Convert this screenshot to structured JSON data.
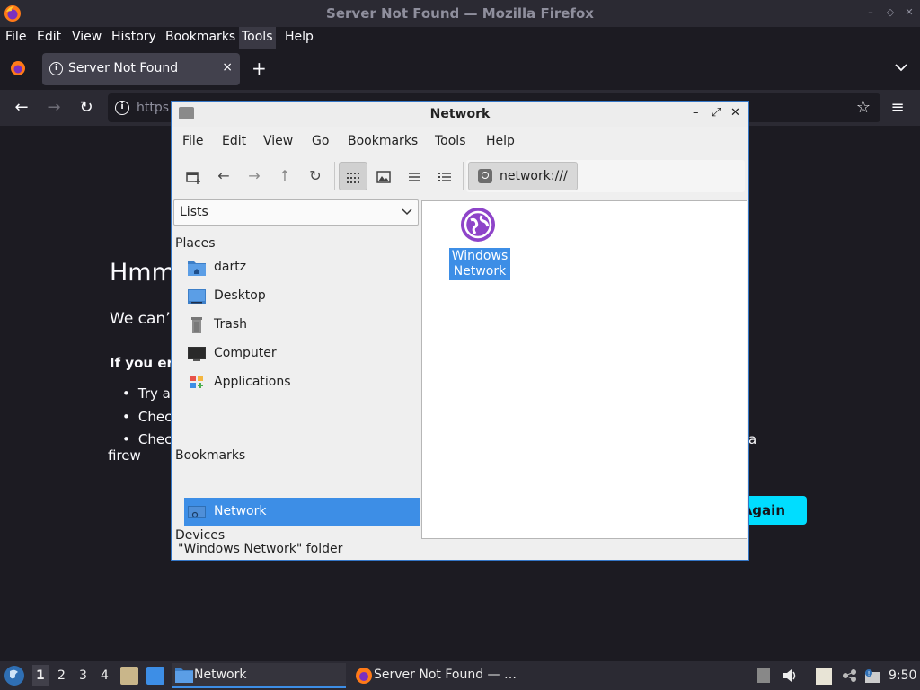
{
  "firefox": {
    "window_title": "Server Not Found — Mozilla Firefox",
    "menu": [
      "File",
      "Edit",
      "View",
      "History",
      "Bookmarks",
      "Tools",
      "Help"
    ],
    "active_menu": "Tools",
    "tab": {
      "label": "Server Not Found",
      "close": "×"
    },
    "new_tab": "+",
    "url_partial": "https",
    "page": {
      "heading_partial": "Hmm",
      "text_partial": "We can’",
      "bold_partial": "If you er",
      "bullets": [
        "Try ac",
        "Chec",
        "Chec",
        "firew"
      ],
      "bullet_tail": "a",
      "try_again_partial": "Again"
    }
  },
  "file_manager": {
    "title": "Network",
    "menu": [
      "File",
      "Edit",
      "View",
      "Go",
      "Bookmarks",
      "Tools",
      "Help"
    ],
    "path": "network:///",
    "side_pane_mode": "Lists",
    "sections": {
      "places": "Places",
      "devices": "Devices",
      "bookmarks": "Bookmarks"
    },
    "places": [
      {
        "label": "dartz",
        "icon": "home-folder-icon"
      },
      {
        "label": "Desktop",
        "icon": "desktop-icon"
      },
      {
        "label": "Trash",
        "icon": "trash-icon"
      },
      {
        "label": "Computer",
        "icon": "computer-icon"
      },
      {
        "label": "Applications",
        "icon": "applications-icon"
      },
      {
        "label": "Network",
        "icon": "network-icon",
        "selected": true
      }
    ],
    "items": [
      {
        "line1": "Windows",
        "line2": "Network",
        "icon": "network-globe-icon",
        "selected": true
      }
    ],
    "status": "\"Windows Network\" folder"
  },
  "taskbar": {
    "workspaces": [
      "1",
      "2",
      "3",
      "4"
    ],
    "active_workspace": "1",
    "tasks": [
      {
        "label": "Network",
        "active": true,
        "icon": "folder-icon"
      },
      {
        "label": "Server Not Found — …",
        "active": false,
        "icon": "firefox-icon"
      }
    ],
    "clock": "9:50"
  },
  "colors": {
    "selection": "#3d8ee6",
    "firefox_bg": "#1c1b22",
    "try_again_button": "#00ddff",
    "network_icon": "#8e44c9"
  }
}
